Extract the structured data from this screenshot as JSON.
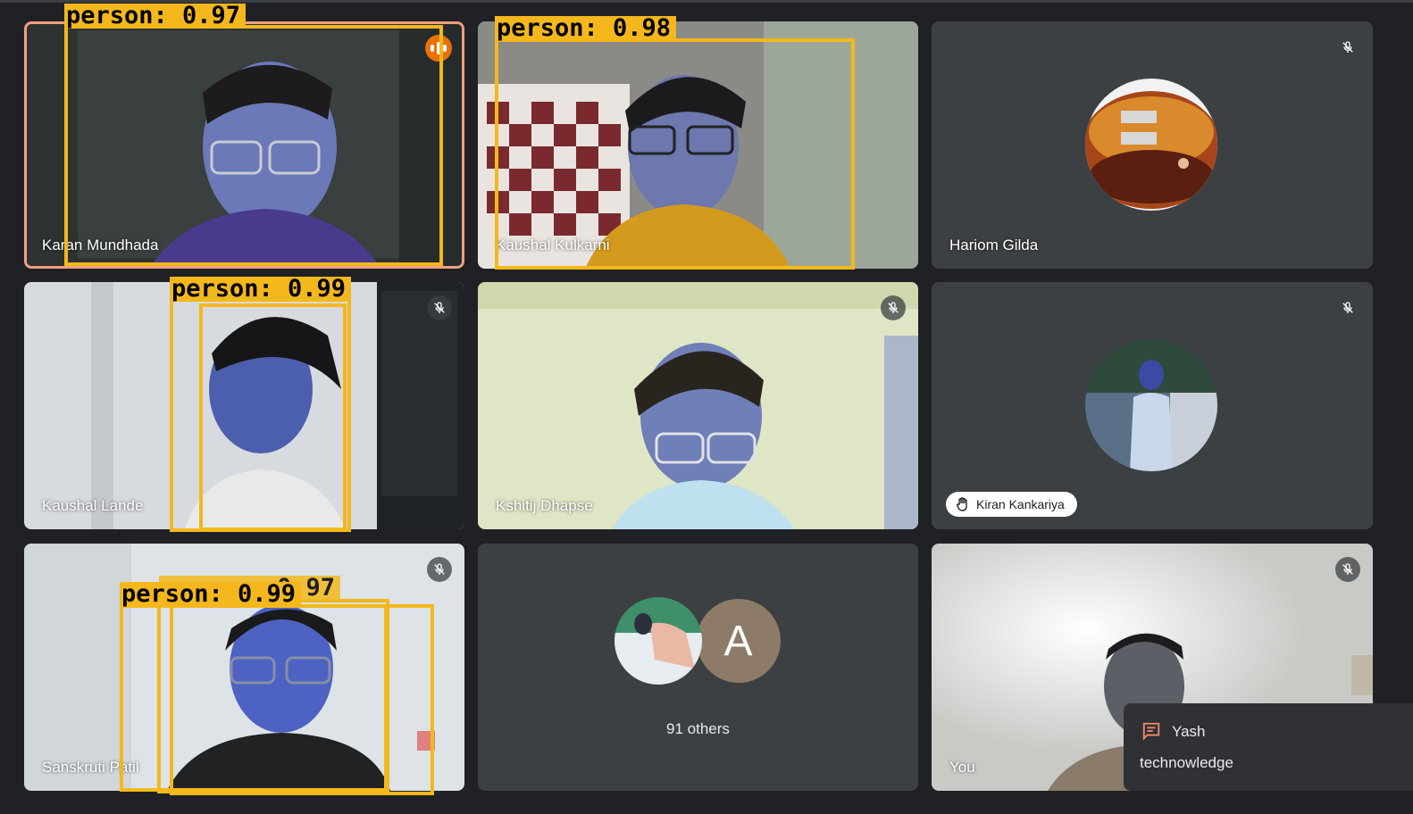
{
  "tiles": [
    {
      "name": "Karan Mundhada",
      "status": "speaking"
    },
    {
      "name": "Kaushal Kulkarni",
      "status": "unmuted"
    },
    {
      "name": "Hariom Gilda",
      "status": "muted"
    },
    {
      "name": "Kaushal Lande",
      "status": "muted"
    },
    {
      "name": "Kshitij Dhapse",
      "status": "muted"
    },
    {
      "name": "Kiran Kankariya",
      "status": "muted",
      "hand_raised": true
    },
    {
      "name": "Sanskruti Patil",
      "status": "muted"
    },
    {
      "name": "You",
      "status": "muted"
    }
  ],
  "others": {
    "avatar_letter": "A",
    "label": "91 others"
  },
  "detections": [
    {
      "label": "person:  0.97"
    },
    {
      "label": "person:  0.98"
    },
    {
      "label": "person:  0.99"
    },
    {
      "label": "person:  0.99"
    },
    {
      "label": "person:  0.97"
    }
  ],
  "chat_notification": {
    "sender": "Yash",
    "message": "technowledge"
  },
  "colors": {
    "background": "#202124",
    "tile": "#3c4043",
    "detection": "#f4b81d",
    "speaking_ring": "#f0a07e",
    "speaking_badge": "#e8710a"
  },
  "icons": [
    "mic-off-icon",
    "speaking-indicator-icon",
    "raised-hand-icon",
    "chat-icon"
  ]
}
